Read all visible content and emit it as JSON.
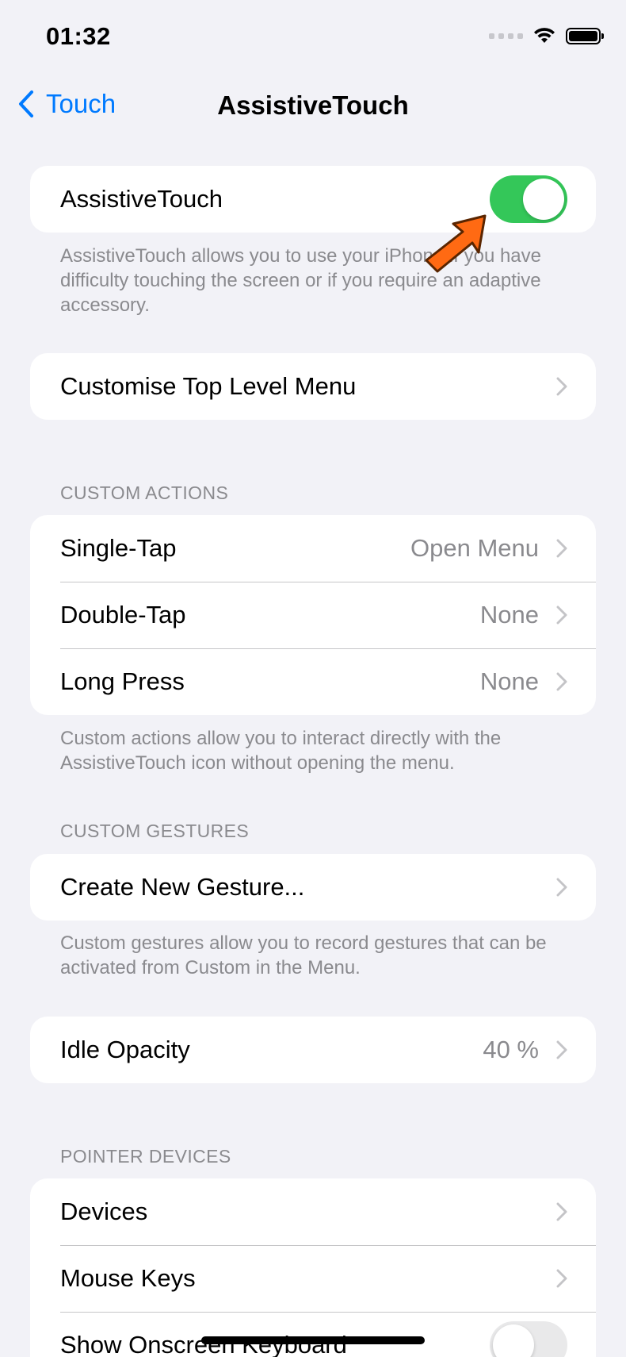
{
  "status_bar": {
    "time": "01:32"
  },
  "nav": {
    "back_label": "Touch",
    "title": "AssistiveTouch"
  },
  "assistive_touch": {
    "label": "AssistiveTouch",
    "enabled": true,
    "footer": "AssistiveTouch allows you to use your iPhone if you have difficulty touching the screen or if you require an adaptive accessory."
  },
  "top_level_menu": {
    "label": "Customise Top Level Menu"
  },
  "custom_actions": {
    "header": "CUSTOM ACTIONS",
    "items": [
      {
        "label": "Single-Tap",
        "value": "Open Menu"
      },
      {
        "label": "Double-Tap",
        "value": "None"
      },
      {
        "label": "Long Press",
        "value": "None"
      }
    ],
    "footer": "Custom actions allow you to interact directly with the AssistiveTouch icon without opening the menu."
  },
  "custom_gestures": {
    "header": "CUSTOM GESTURES",
    "create_label": "Create New Gesture...",
    "footer": "Custom gestures allow you to record gestures that can be activated from Custom in the Menu."
  },
  "idle_opacity": {
    "label": "Idle Opacity",
    "value": "40 %"
  },
  "pointer_devices": {
    "header": "POINTER DEVICES",
    "items": [
      {
        "label": "Devices"
      },
      {
        "label": "Mouse Keys"
      }
    ],
    "onscreen_keyboard": {
      "label": "Show Onscreen Keyboard",
      "enabled": false
    }
  },
  "colors": {
    "accent": "#007aff",
    "toggle_on": "#34c759",
    "arrow": "#ff6a13"
  }
}
